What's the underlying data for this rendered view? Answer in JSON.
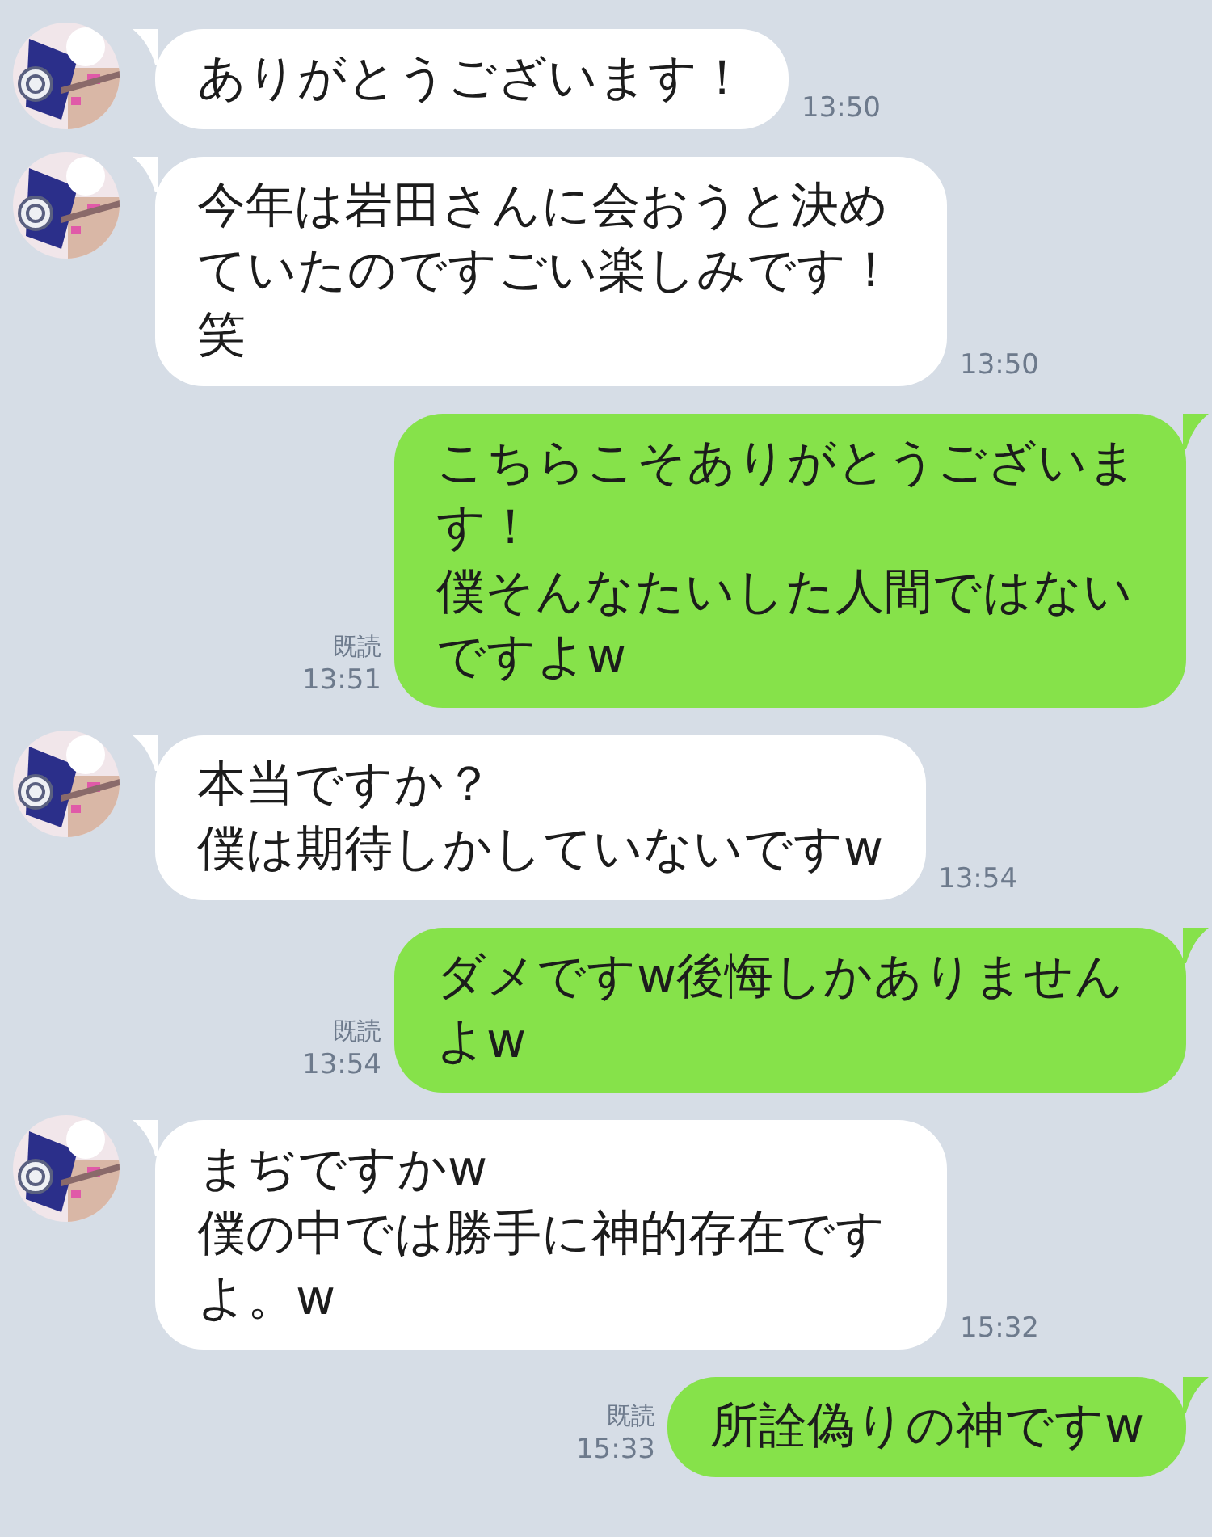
{
  "messages": [
    {
      "kind": "incoming",
      "lines": [
        "ありがとうございます！"
      ],
      "time": "13:50"
    },
    {
      "kind": "incoming",
      "lines": [
        "今年は岩田さんに会おうと決めていたのですごい楽しみです！笑"
      ],
      "time": "13:50"
    },
    {
      "kind": "outgoing",
      "lines": [
        "こちらこそありがとうございます！",
        "僕そんなたいした人間ではないですよw"
      ],
      "time": "13:51",
      "read_label": "既読"
    },
    {
      "kind": "incoming",
      "lines": [
        "本当ですか？",
        "僕は期待しかしていないですw"
      ],
      "time": "13:54"
    },
    {
      "kind": "outgoing",
      "lines": [
        "ダメですw後悔しかありませんよw"
      ],
      "time": "13:54",
      "read_label": "既読"
    },
    {
      "kind": "incoming",
      "lines": [
        "まぢですかw",
        "僕の中では勝手に神的存在ですよ。w"
      ],
      "time": "15:32"
    },
    {
      "kind": "outgoing",
      "lines": [
        "所詮偽りの神ですw"
      ],
      "time": "15:33",
      "read_label": "既読"
    }
  ]
}
